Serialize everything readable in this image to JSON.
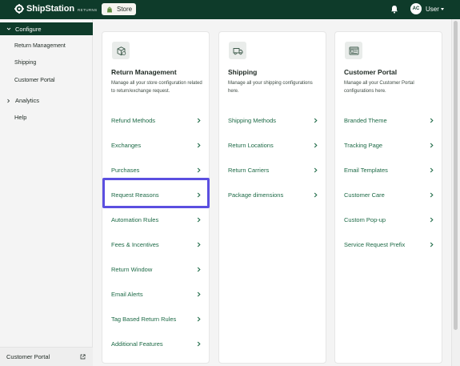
{
  "header": {
    "brand_name": "ShipStation",
    "brand_sub": "RETURNS",
    "store_label": "Store",
    "avatar_initials": "AC",
    "user_name": "User"
  },
  "sidebar": {
    "configure_label": "Configure",
    "sub_items": [
      {
        "label": "Return Management"
      },
      {
        "label": "Shipping"
      },
      {
        "label": "Customer Portal"
      }
    ],
    "analytics_label": "Analytics",
    "help_label": "Help",
    "footer_label": "Customer Portal"
  },
  "cards": [
    {
      "icon": "box-return-icon",
      "title": "Return Management",
      "description": "Manage all your store configuration related to return/exchange request.",
      "items": [
        {
          "label": "Refund Methods"
        },
        {
          "label": "Exchanges"
        },
        {
          "label": "Purchases"
        },
        {
          "label": "Request Reasons"
        },
        {
          "label": "Automation Rules"
        },
        {
          "label": "Fees & Incentives"
        },
        {
          "label": "Return Window"
        },
        {
          "label": "Email Alerts"
        },
        {
          "label": "Tag Based Return Rules"
        },
        {
          "label": "Additional Features"
        }
      ]
    },
    {
      "icon": "truck-icon",
      "title": "Shipping",
      "description": "Manage all your shipping configurations here.",
      "items": [
        {
          "label": "Shipping Methods"
        },
        {
          "label": "Return Locations"
        },
        {
          "label": "Return Carriers"
        },
        {
          "label": "Package dimensions"
        }
      ]
    },
    {
      "icon": "portal-icon",
      "title": "Customer Portal",
      "description": "Manage all your Customer Portal configurations here.",
      "items": [
        {
          "label": "Branded Theme"
        },
        {
          "label": "Tracking Page"
        },
        {
          "label": "Email Templates"
        },
        {
          "label": "Customer Care"
        },
        {
          "label": "Custom Pop-up"
        },
        {
          "label": "Service Request Prefix"
        }
      ]
    }
  ],
  "colors": {
    "topbar": "#0e3b2a",
    "link": "#1d6a46",
    "highlight": "#5b4fe0"
  }
}
